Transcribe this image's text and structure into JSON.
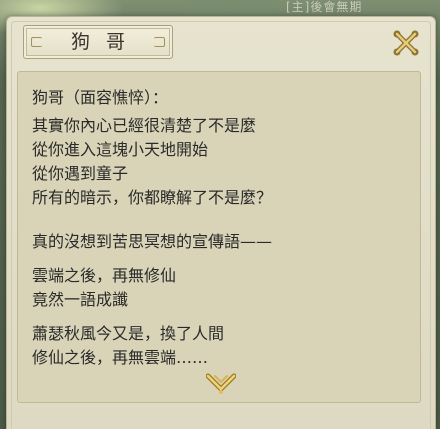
{
  "hud": {
    "top_quest_text": "[主]後會無期"
  },
  "dialog": {
    "title": "狗哥",
    "speaker_line": "狗哥（面容憔悴）：",
    "lines": [
      "其實你內心已經很清楚了不是麼",
      "從你進入這塊小天地開始",
      "從你遇到童子",
      "所有的暗示，你都瞭解了不是麼？",
      "真的沒想到苦思冥想的宣傳語——",
      "雲端之後，再無修仙",
      "竟然一語成讖",
      "蕭瑟秋風今又是，換了人間",
      "修仙之後，再無雲端……"
    ]
  },
  "icons": {
    "close": "close-x-icon",
    "continue": "continue-arrow-icon"
  },
  "colors": {
    "dialog_bg": "#e6e3cf",
    "panel_bg": "#d9d4b8",
    "text": "#2a2a2a",
    "accent_gold": "#c9a545"
  }
}
